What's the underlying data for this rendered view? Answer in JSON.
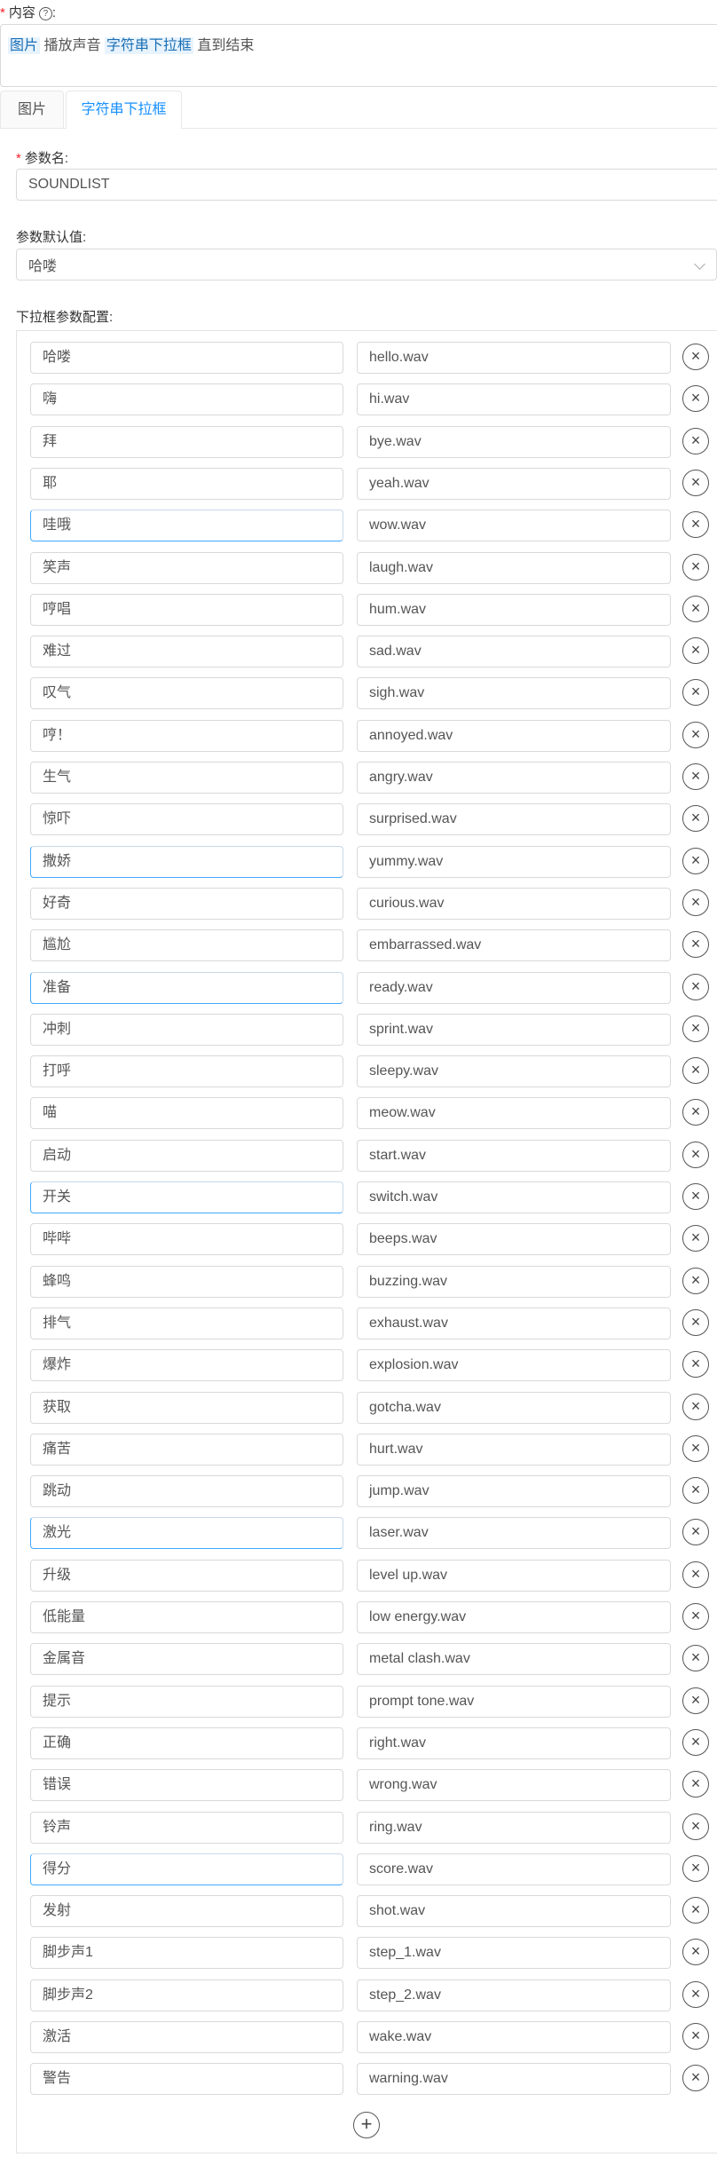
{
  "content": {
    "required_mark": "*",
    "label": "内容",
    "help_icon": "question-circle-icon",
    "tokens": [
      {
        "text": "图片",
        "tagged": true
      },
      {
        "text": " 播放声音 ",
        "tagged": false
      },
      {
        "text": "字符串下拉框",
        "tagged": true
      },
      {
        "text": " 直到结束",
        "tagged": false
      }
    ]
  },
  "tabs": [
    {
      "label": "图片",
      "active": false
    },
    {
      "label": "字符串下拉框",
      "active": true
    }
  ],
  "param_name": {
    "required_mark": "*",
    "label": "参数名:",
    "value": "SOUNDLIST"
  },
  "param_default": {
    "label": "参数默认值:",
    "value": "哈喽"
  },
  "dropdown_config": {
    "label": "下拉框参数配置:",
    "rows": [
      {
        "key": "哈喽",
        "value": "hello.wav"
      },
      {
        "key": "嗨",
        "value": "hi.wav"
      },
      {
        "key": "拜",
        "value": "bye.wav"
      },
      {
        "key": "耶",
        "value": "yeah.wav"
      },
      {
        "key": "哇哦",
        "value": "wow.wav",
        "focused": true
      },
      {
        "key": "笑声",
        "value": "laugh.wav"
      },
      {
        "key": "哼唱",
        "value": "hum.wav"
      },
      {
        "key": "难过",
        "value": "sad.wav"
      },
      {
        "key": "叹气",
        "value": "sigh.wav"
      },
      {
        "key": "哼！",
        "value": "annoyed.wav"
      },
      {
        "key": "生气",
        "value": "angry.wav"
      },
      {
        "key": "惊吓",
        "value": "surprised.wav"
      },
      {
        "key": "撒娇",
        "value": "yummy.wav",
        "focused": true
      },
      {
        "key": "好奇",
        "value": "curious.wav"
      },
      {
        "key": "尴尬",
        "value": "embarrassed.wav"
      },
      {
        "key": "准备",
        "value": "ready.wav",
        "focused": true
      },
      {
        "key": "冲刺",
        "value": "sprint.wav"
      },
      {
        "key": "打呼",
        "value": "sleepy.wav"
      },
      {
        "key": "喵",
        "value": "meow.wav"
      },
      {
        "key": "启动",
        "value": "start.wav"
      },
      {
        "key": "开关",
        "value": "switch.wav",
        "focused": true
      },
      {
        "key": "哔哔",
        "value": "beeps.wav"
      },
      {
        "key": "蜂鸣",
        "value": "buzzing.wav"
      },
      {
        "key": "排气",
        "value": "exhaust.wav"
      },
      {
        "key": "爆炸",
        "value": "explosion.wav"
      },
      {
        "key": "获取",
        "value": "gotcha.wav"
      },
      {
        "key": "痛苦",
        "value": "hurt.wav"
      },
      {
        "key": "跳动",
        "value": "jump.wav"
      },
      {
        "key": "激光",
        "value": "laser.wav",
        "focused": true
      },
      {
        "key": "升级",
        "value": "level up.wav"
      },
      {
        "key": "低能量",
        "value": "low energy.wav"
      },
      {
        "key": "金属音",
        "value": "metal clash.wav"
      },
      {
        "key": "提示",
        "value": "prompt tone.wav"
      },
      {
        "key": "正确",
        "value": "right.wav"
      },
      {
        "key": "错误",
        "value": "wrong.wav"
      },
      {
        "key": "铃声",
        "value": "ring.wav"
      },
      {
        "key": "得分",
        "value": "score.wav",
        "focused": true
      },
      {
        "key": "发射",
        "value": "shot.wav"
      },
      {
        "key": "脚步声1",
        "value": "step_1.wav"
      },
      {
        "key": "脚步声2",
        "value": "step_2.wav"
      },
      {
        "key": "激活",
        "value": "wake.wav"
      },
      {
        "key": "警告",
        "value": "warning.wav"
      }
    ],
    "remove_icon": "close-circle-icon",
    "remove_glyph": "×",
    "add_icon": "plus-circle-icon",
    "add_glyph": "+"
  },
  "colors": {
    "accent": "#1890ff",
    "required": "#f5222d",
    "tag_bg": "#e8f3fd",
    "float_button": "#16c0a0"
  }
}
